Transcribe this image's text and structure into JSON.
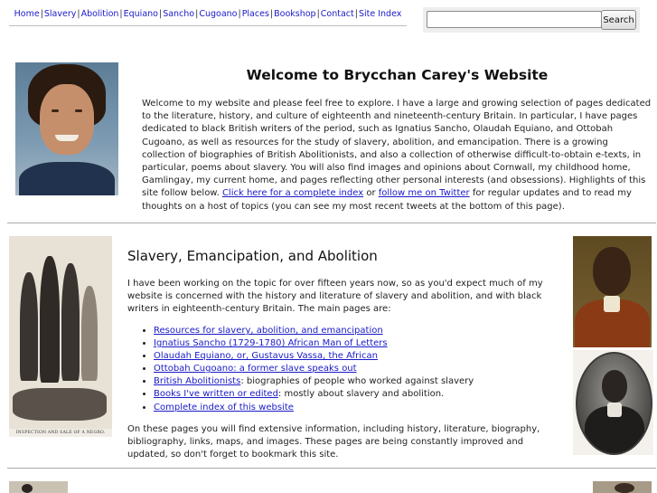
{
  "nav": {
    "links": [
      "Home",
      "Slavery",
      "Abolition",
      "Equiano",
      "Sancho",
      "Cugoano",
      "Places",
      "Bookshop",
      "Contact",
      "Site Index"
    ],
    "separator": "|"
  },
  "search": {
    "value": "",
    "placeholder": "",
    "button_label": "Search"
  },
  "welcome": {
    "title": "Welcome to Brycchan Carey's Website",
    "intro_text": "Welcome to my website and please feel free to explore. I have a large and growing selection of pages dedicated to the literature, history, and culture of eighteenth and nineteenth-century Britain. In particular, I have pages dedicated to black British writers of the period, such as Ignatius Sancho, Olaudah Equiano, and Ottobah Cugoano, as well as resources for the study of slavery, abolition, and emancipation. There is a growing collection of biographies of British Abolitionists, and also a collection of otherwise difficult-to-obtain e-texts, in particular, poems about slavery. You will also find images and opinions about Cornwall, my childhood home, Gamlingay, my current home, and pages reflecting other personal interests (and obsessions). Highlights of this site follow below. ",
    "link_index": "Click here for a complete index",
    "or_text": " or ",
    "link_twitter": "follow me on Twitter",
    "outro_text": " for regular updates and to read my thoughts on a host of topics (you can see my most recent tweets at the bottom of this page)."
  },
  "slavery": {
    "title": "Slavery, Emancipation, and Abolition",
    "intro": "I have been working on the topic for over fifteen years now, so as you'd expect much of my website is concerned with the history and literature of slavery and abolition, and with black writers in eighteenth-century Britain. The main pages are:",
    "items": [
      {
        "link": "Resources for slavery, abolition, and emancipation",
        "suffix": ""
      },
      {
        "link": "Ignatius Sancho (1729-1780) African Man of Letters",
        "suffix": ""
      },
      {
        "link": "Olaudah Equiano, or, Gustavus Vassa, the African",
        "suffix": ""
      },
      {
        "link": "Ottobah Cugoano: a former slave speaks out",
        "suffix": ""
      },
      {
        "link": "British Abolitionists",
        "suffix": ": biographies of people who worked against slavery"
      },
      {
        "link": "Books I've written or edited",
        "suffix": ": mostly about slavery and abolition."
      },
      {
        "link": "Complete index of this website",
        "suffix": ""
      }
    ],
    "closing": "On these pages you will find extensive information, including history, literature, biography, bibliography, links, maps, and images. These pages are being constantly improved and updated, so don't forget to bookmark this site.",
    "engraving_caption": "INSPECTION AND SALE OF A NEGRO."
  }
}
